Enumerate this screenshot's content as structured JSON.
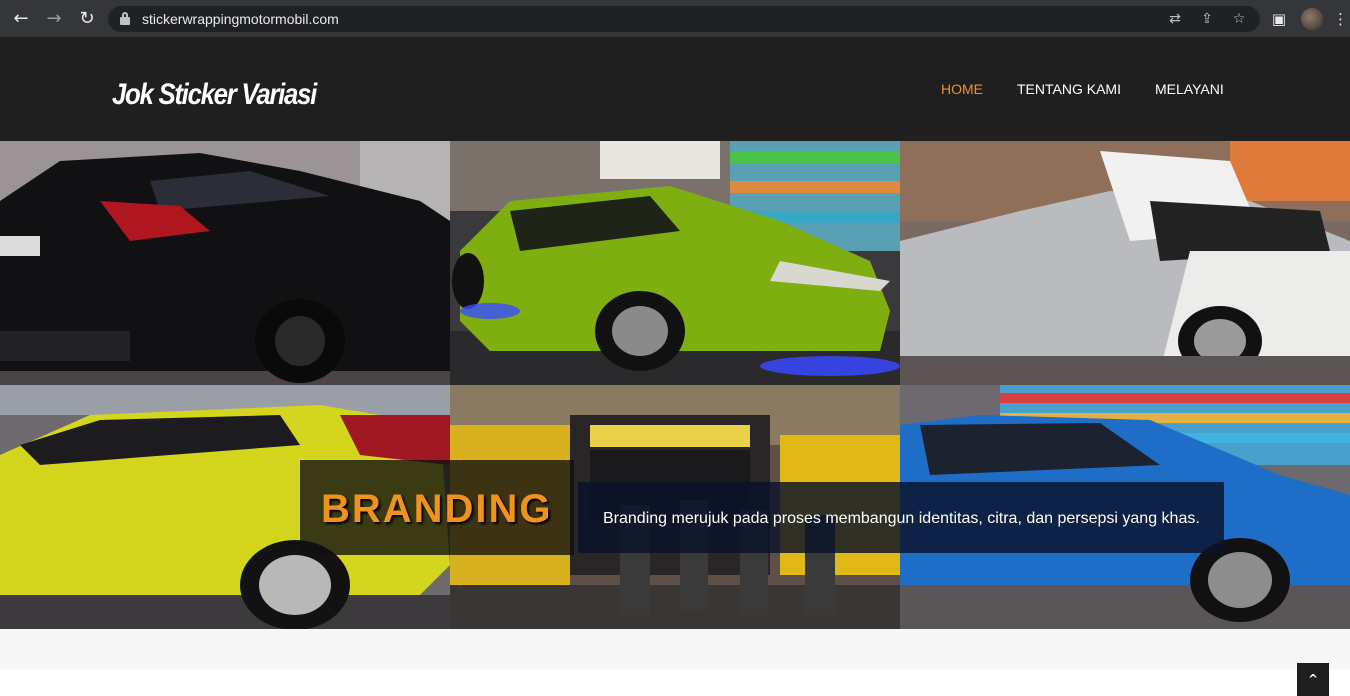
{
  "browser": {
    "url": "stickerwrappingmotormobil.com",
    "icons": [
      "back-icon",
      "forward-icon",
      "reload-icon",
      "lock-icon",
      "translate-icon",
      "share-icon",
      "star-icon",
      "side-panel-icon",
      "profile-avatar",
      "more-icon"
    ]
  },
  "site": {
    "logo": "Jok Sticker Variasi",
    "nav": [
      "HOME",
      "TENTANG KAMI",
      "MELAYANI"
    ],
    "active_nav": "HOME",
    "accent_color": "#f0921e"
  },
  "hero": {
    "title": "BRANDING",
    "description": "Branding merujuk pada proses membangun identitas, citra, dan persepsi yang khas.",
    "photos": [
      "black-suv-photo",
      "lime-green-hatchback-photo",
      "silver-white-car-photo",
      "yellow-hatchback-photo",
      "truck-group-photo",
      "blue-sedan-photo"
    ]
  },
  "scroll_top_icon": "chevron-up-icon"
}
